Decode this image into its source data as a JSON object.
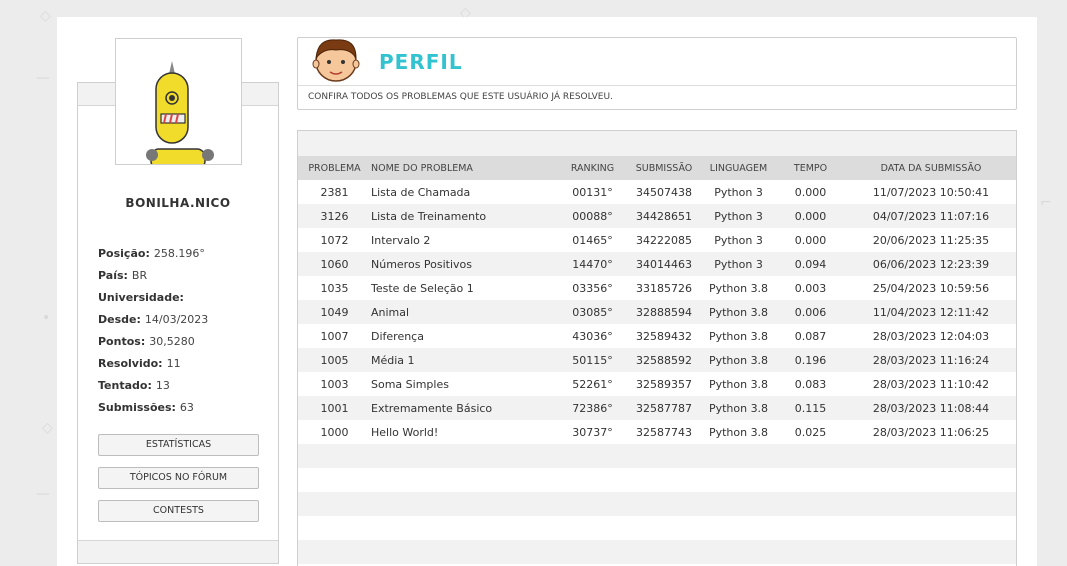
{
  "profile": {
    "username": "BONILHA.NICO",
    "fields": [
      {
        "label": "Posição:",
        "value": "258.196°"
      },
      {
        "label": "País:",
        "value": "BR"
      },
      {
        "label": "Universidade:",
        "value": ""
      },
      {
        "label": "Desde:",
        "value": "14/03/2023"
      },
      {
        "label": "Pontos:",
        "value": "30,5280"
      },
      {
        "label": "Resolvido:",
        "value": "11"
      },
      {
        "label": "Tentado:",
        "value": "13"
      },
      {
        "label": "Submissões:",
        "value": "63"
      }
    ],
    "buttons": {
      "stats": "ESTATÍSTICAS",
      "forum": "TÓPICOS NO FÓRUM",
      "contests": "CONTESTS"
    }
  },
  "header": {
    "title": "PERFIL",
    "subtitle": "CONFIRA TODOS OS PROBLEMAS QUE ESTE USUÁRIO JÁ RESOLVEU.",
    "accent": "#32c3d0"
  },
  "table": {
    "columns": [
      "PROBLEMA",
      "NOME DO PROBLEMA",
      "RANKING",
      "SUBMISSÃO",
      "LINGUAGEM",
      "TEMPO",
      "DATA DA SUBMISSÃO"
    ],
    "rows": [
      [
        "2381",
        "Lista de Chamada",
        "00131°",
        "34507438",
        "Python 3",
        "0.000",
        "11/07/2023 10:50:41"
      ],
      [
        "3126",
        "Lista de Treinamento",
        "00088°",
        "34428651",
        "Python 3",
        "0.000",
        "04/07/2023 11:07:16"
      ],
      [
        "1072",
        "Intervalo 2",
        "01465°",
        "34222085",
        "Python 3",
        "0.000",
        "20/06/2023 11:25:35"
      ],
      [
        "1060",
        "Números Positivos",
        "14470°",
        "34014463",
        "Python 3",
        "0.094",
        "06/06/2023 12:23:39"
      ],
      [
        "1035",
        "Teste de Seleção 1",
        "03356°",
        "33185726",
        "Python 3.8",
        "0.003",
        "25/04/2023 10:59:56"
      ],
      [
        "1049",
        "Animal",
        "03085°",
        "32888594",
        "Python 3.8",
        "0.006",
        "11/04/2023 12:11:42"
      ],
      [
        "1007",
        "Diferença",
        "43036°",
        "32589432",
        "Python 3.8",
        "0.087",
        "28/03/2023 12:04:03"
      ],
      [
        "1005",
        "Média 1",
        "50115°",
        "32588592",
        "Python 3.8",
        "0.196",
        "28/03/2023 11:16:24"
      ],
      [
        "1003",
        "Soma Simples",
        "52261°",
        "32589357",
        "Python 3.8",
        "0.083",
        "28/03/2023 11:10:42"
      ],
      [
        "1001",
        "Extremamente Básico",
        "72386°",
        "32587787",
        "Python 3.8",
        "0.115",
        "28/03/2023 11:08:44"
      ],
      [
        "1000",
        "Hello World!",
        "30737°",
        "32587743",
        "Python 3.8",
        "0.025",
        "28/03/2023 11:06:25"
      ]
    ],
    "empty_rows": 5
  }
}
